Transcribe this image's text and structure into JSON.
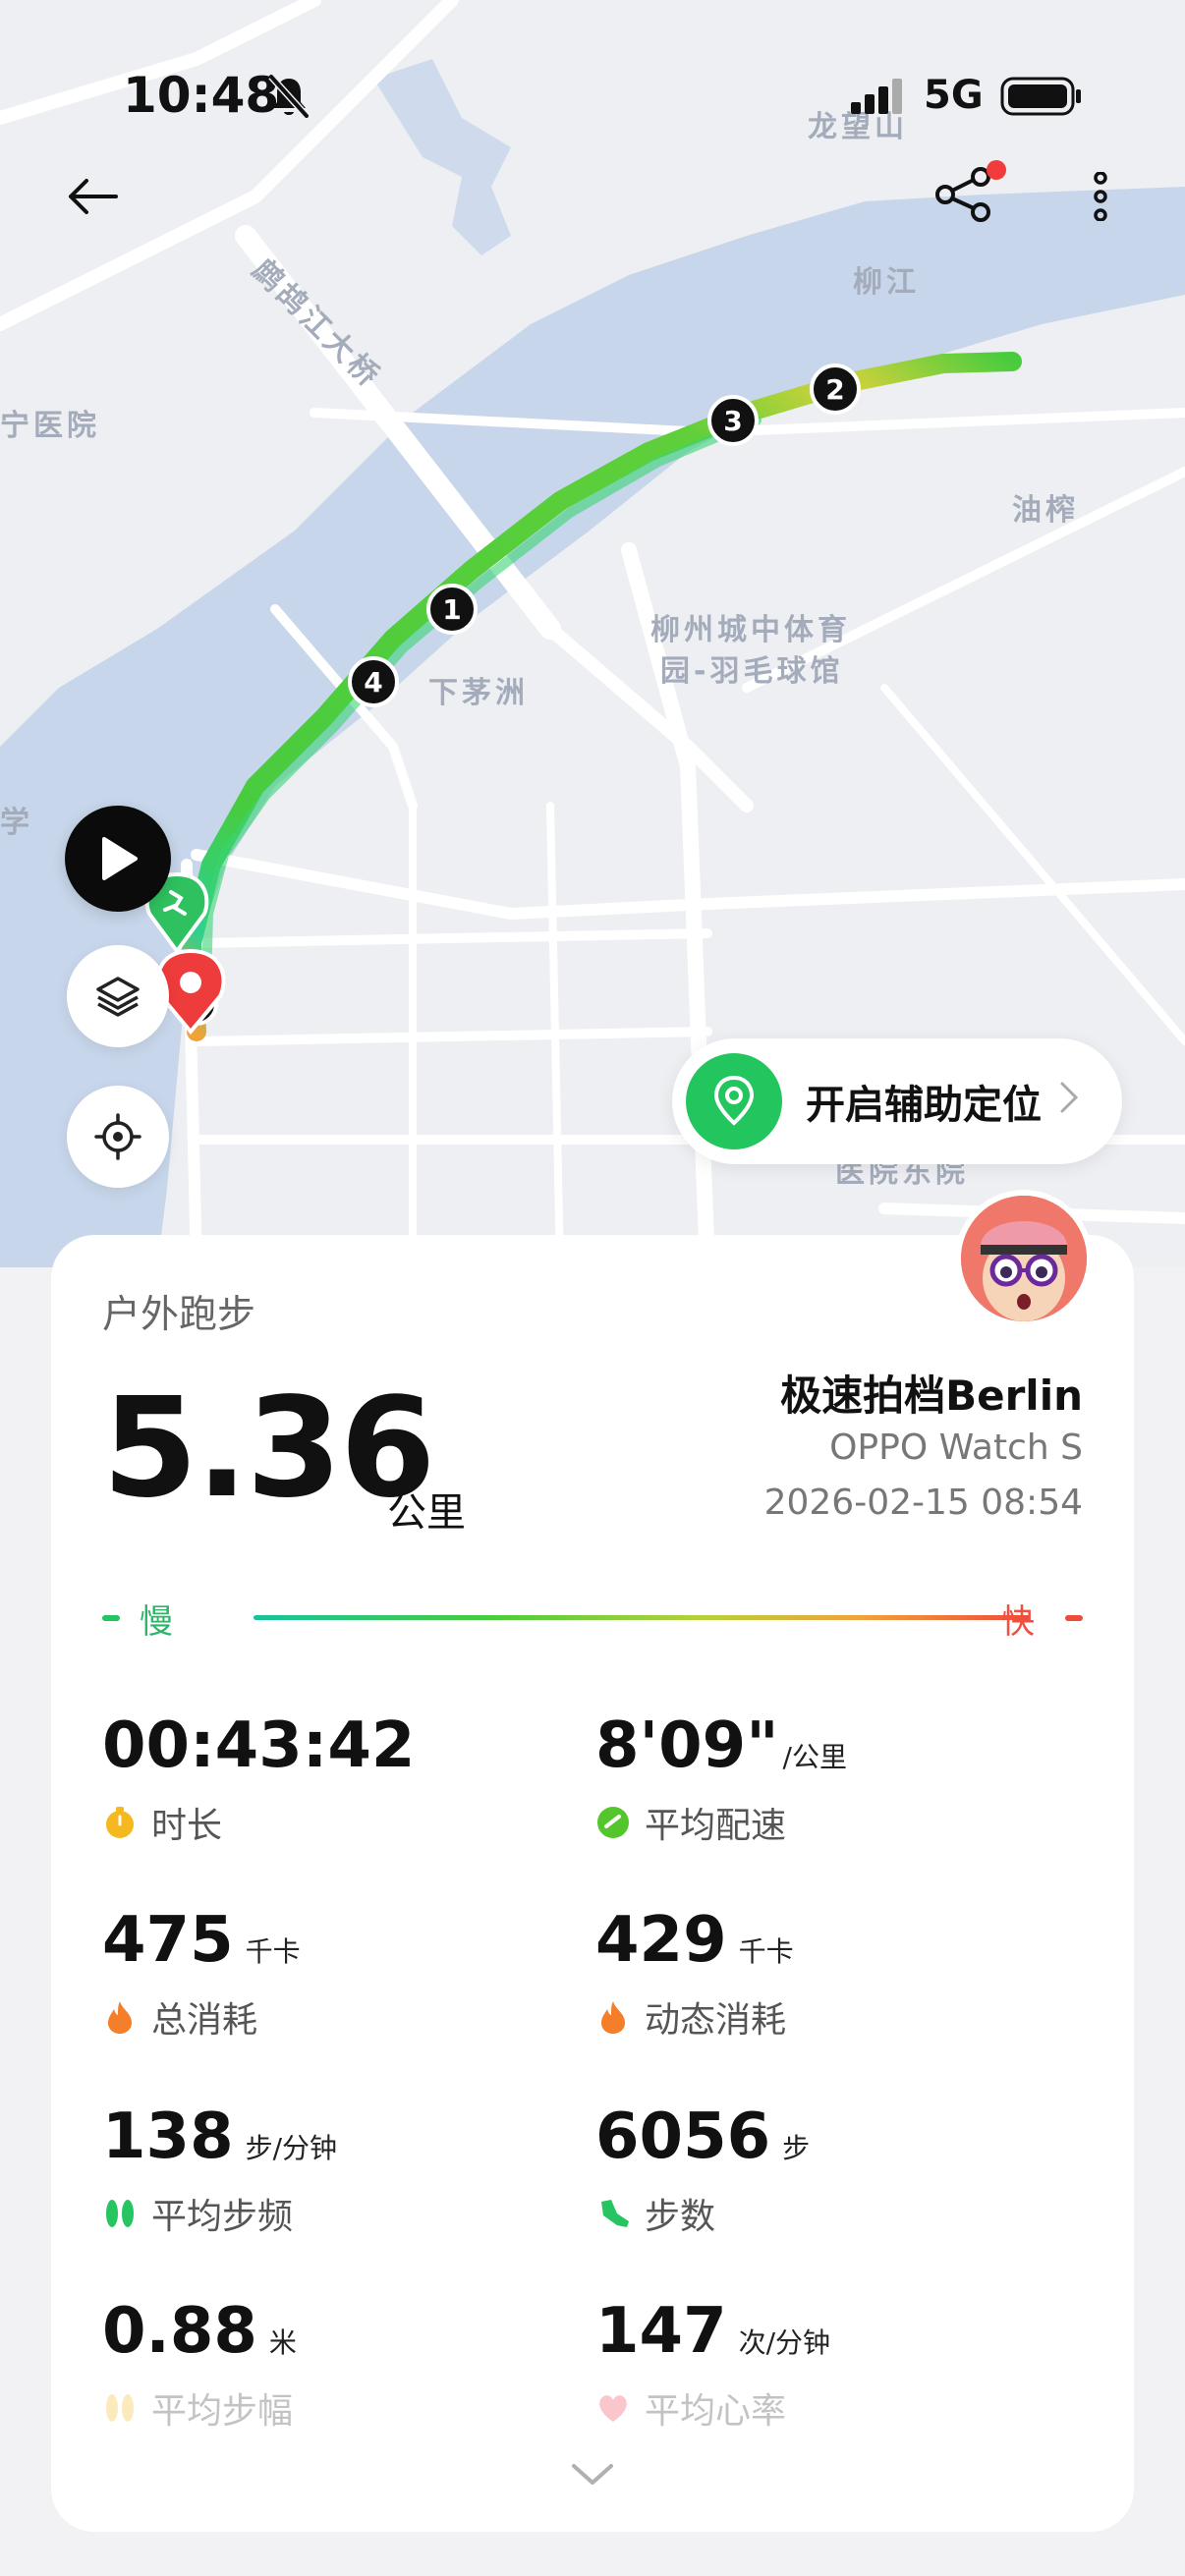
{
  "status_bar": {
    "time": "10:48",
    "network": "5G"
  },
  "map": {
    "labels": {
      "longwang": "龙望山",
      "liujiang": "柳江",
      "bridge": "鹧鸪江大桥",
      "hospital": "宁医院",
      "youzha": "油榨",
      "stadium_1": "柳州城中体育",
      "stadium_2": "园-羽毛球馆",
      "xiamaozhou": "下茅洲",
      "xue": "学",
      "hospital_east": "医院东院"
    },
    "route_markers": [
      "1",
      "2",
      "3",
      "4"
    ],
    "assist_button_label": "开启辅助定位",
    "colors": {
      "water": "#c7d6ea",
      "route_green": "#42cc3b",
      "route_yellow": "#d6d23a",
      "marker_start": "#22c55e",
      "marker_end": "#ee3b3b"
    }
  },
  "card": {
    "activity_type": "户外跑步",
    "distance": "5.36",
    "distance_unit": "公里",
    "device_name": "极速拍档Berlin",
    "device_model": "OPPO Watch S",
    "datetime": "2026-02-15 08:54",
    "pace_legend": {
      "slow": "慢",
      "fast": "快"
    },
    "stats": [
      {
        "value": "00:43:42",
        "unit": "",
        "label": "时长",
        "icon": "stopwatch-icon",
        "color": "#f5b81e"
      },
      {
        "value": "8'09\"",
        "unit": "/公里",
        "label": "平均配速",
        "icon": "pace-icon",
        "color": "#54c62c"
      },
      {
        "value": "475",
        "unit": "千卡",
        "label": "总消耗",
        "icon": "flame-icon",
        "color": "#f57e2a"
      },
      {
        "value": "429",
        "unit": "千卡",
        "label": "动态消耗",
        "icon": "flame-icon",
        "color": "#f57e2a"
      },
      {
        "value": "138",
        "unit": "步/分钟",
        "label": "平均步频",
        "icon": "footprints-icon",
        "color": "#27c462"
      },
      {
        "value": "6056",
        "unit": "步",
        "label": "步数",
        "icon": "shoe-icon",
        "color": "#27c462"
      },
      {
        "value": "0.88",
        "unit": "米",
        "label": "平均步幅",
        "icon": "footprints-icon",
        "color": "#f5c542"
      },
      {
        "value": "147",
        "unit": "次/分钟",
        "label": "平均心率",
        "icon": "heart-icon",
        "color": "#f25c6c"
      }
    ]
  }
}
